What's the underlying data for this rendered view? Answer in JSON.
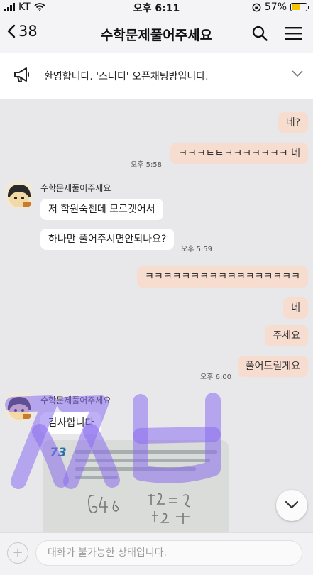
{
  "status_bar": {
    "carrier": "KT",
    "time": "오후 6:11",
    "battery": "57%",
    "battery_level": 0.57
  },
  "header": {
    "back_count": "38",
    "title": "수학문제풀어주세요",
    "search_icon": "search-icon",
    "menu_icon": "menu-icon"
  },
  "notice": {
    "text": "환영합니다. '스터디' 오픈채팅방입니다."
  },
  "messages": {
    "m1": "네?",
    "m2": "ㅋㅋㅋㅌㅌㅋㅋㅋㅋㅋㅋㅋ 네",
    "t1": "오후 5:58",
    "sender1": "수학문제풀어주세요",
    "m3": "저 학원숙젠데 모르겟어서",
    "m4": "하나만 풀어주시면안되나요?",
    "t2": "오후 5:59",
    "m5": "ㅋㅋㅋㅋㅋㅋㅋㅋㅋㅋㅋㅋㅋㅋㅋㅋㅋ",
    "m6": "네",
    "m7": "주세요",
    "m8": "풀어드릴게요",
    "t3": "오후 6:00",
    "sender2": "수학문제풀어주세요",
    "m9": "감사합니다"
  },
  "photo": {
    "problem_number": "73"
  },
  "input": {
    "placeholder": "대화가 불가능한 상태입니다."
  },
  "colors": {
    "my_bubble": "#f7dcd0",
    "other_bubble": "#ffffff",
    "chat_bg": "#e8e8ea",
    "watermark": "#8a6df0"
  }
}
